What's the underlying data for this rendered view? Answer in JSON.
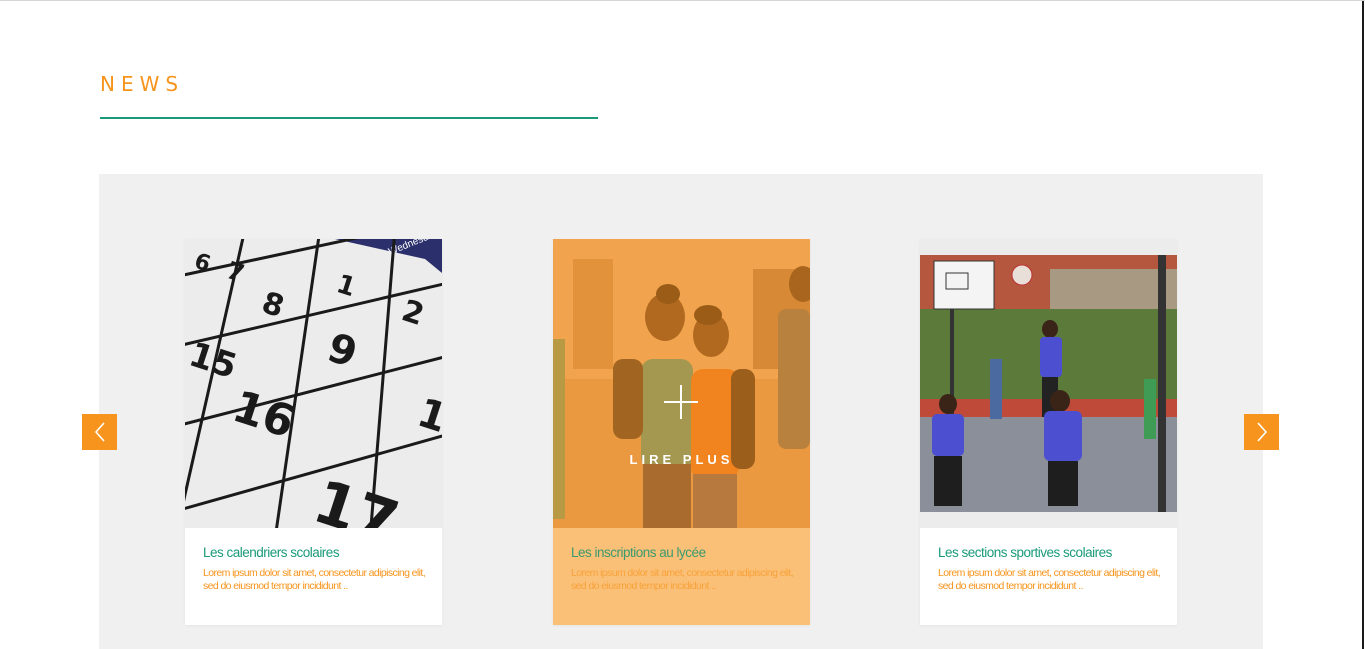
{
  "section": {
    "title": "NEWS"
  },
  "carousel": {
    "prev_icon": "chevron-left-icon",
    "next_icon": "chevron-right-icon",
    "cards": [
      {
        "title": "Les calendriers scolaires",
        "text": "Lorem ipsum dolor sit amet, consectetur adipiscing elit, sed do eiusmod tempor incididunt ..",
        "image": "calendar-photo"
      },
      {
        "title": "Les inscriptions au lycée",
        "text": "Lorem ipsum dolor sit amet, consectetur adipiscing elit, sed do eiusmod tempor incididunt ..",
        "image": "students-photo",
        "hover_label": "LIRE PLUS",
        "hover_icon": "plus-icon"
      },
      {
        "title": "Les sections sportives scolaires",
        "text": "Lorem ipsum dolor sit amet, consectetur adipiscing elit, sed do eiusmod tempor incididunt ..",
        "image": "basketball-photo"
      }
    ]
  },
  "colors": {
    "accent": "#f7941d",
    "green": "#1a9a7a",
    "carousel_bg": "#f0f0f0",
    "active_card_bg": "#fbc077"
  }
}
